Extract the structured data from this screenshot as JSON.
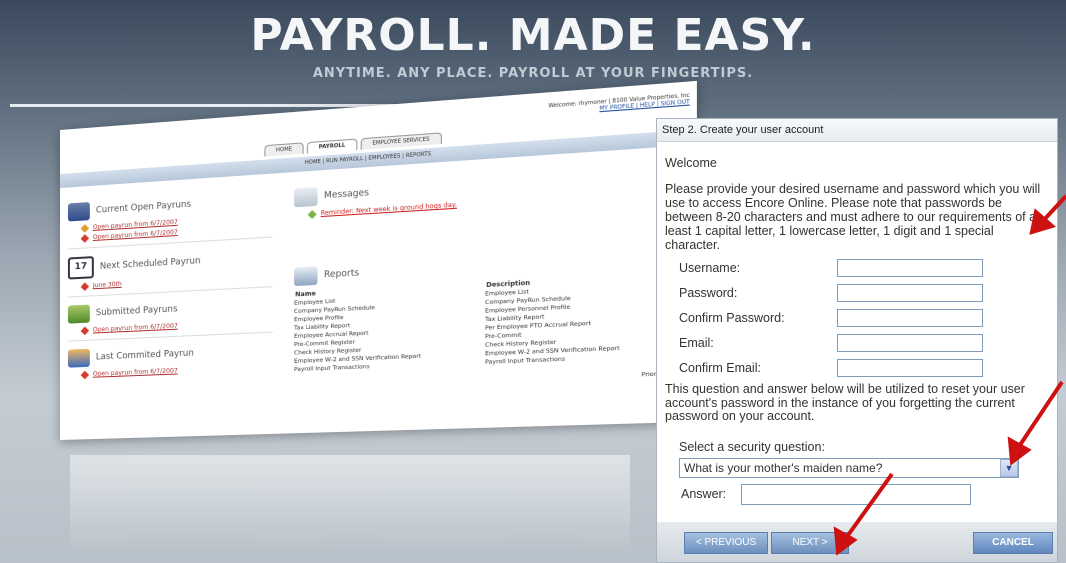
{
  "hero": {
    "title": "PAYROLL. MADE EASY.",
    "subtitle": "ANYTIME. ANY PLACE.  PAYROLL AT YOUR FINGERTIPS."
  },
  "mock": {
    "tabs": [
      "HOME",
      "PAYROLL",
      "EMPLOYEE SERVICES"
    ],
    "welcome_line": "Welcome: rhymoner | 8100 Value Properties, Inc",
    "welcome_links": "MY PROFILE | HELP | SIGN OUT",
    "subnav": "HOME | RUN PAYROLL | EMPLOYEES | REPORTS",
    "current_open_payruns": {
      "title": "Current Open Payruns",
      "items": [
        "Open payrun from 6/7/2007",
        "Open payrun from 6/7/2007"
      ]
    },
    "next_scheduled": {
      "title": "Next Scheduled Payrun",
      "date_icon": "17",
      "items": [
        "June 30th"
      ]
    },
    "submitted": {
      "title": "Submitted Payruns",
      "items": [
        "Open payrun from 6/7/2007"
      ]
    },
    "last_committed": {
      "title": "Last Commited Payrun",
      "items": [
        "Open payrun from 6/7/2007"
      ]
    },
    "messages": {
      "title": "Messages",
      "item": "Reminder: Next week is ground hogs day."
    },
    "reports": {
      "title": "Reports",
      "col_name": "Name",
      "col_desc": "Description",
      "rows": [
        [
          "Employee List",
          "Employee List"
        ],
        [
          "Company PayRun Schedule",
          "Company PayRun Schedule"
        ],
        [
          "Employee Profile",
          "Employee Personnel Profile"
        ],
        [
          "Tax Liability Report",
          "Tax Liability Report"
        ],
        [
          "Employee Accrual Report",
          "Per Employee PTO Accrual Report"
        ],
        [
          "Pre-Commit Register",
          "Pre-Commit"
        ],
        [
          "Check History Register",
          "Check History Register"
        ],
        [
          "Employee W-2 and SSN Verification Report",
          "Employee W-2 and SSN Verification Report"
        ],
        [
          "Payroll Input Transactions",
          "Payroll Input Transactions"
        ]
      ],
      "priority_label": "Priority Levels"
    }
  },
  "panel": {
    "header": "Step 2. Create your user account",
    "welcome": "Welcome",
    "intro": "Please provide your desired username and password which you will use to access Encore Online. Please note that passwords be between 8-20 characters and must adhere to our requirements of at least 1 capital letter, 1 lowercase letter, 1 digit and 1 special character.",
    "fields": {
      "username": "Username:",
      "password": "Password:",
      "confirm_password": "Confirm Password:",
      "email": "Email:",
      "confirm_email": "Confirm Email:"
    },
    "question_note": "This question and answer below will be utilized to reset your user account's password in the instance of you forgetting the current password on your account.",
    "select_label": "Select a security question:",
    "select_value": "What is your mother's maiden name?",
    "answer_label": "Answer:",
    "buttons": {
      "previous": "< PREVIOUS",
      "next": "NEXT >",
      "cancel": "CANCEL"
    }
  },
  "colors": {
    "annotation_arrow": "#cc1111",
    "button_blue": "#6b8fbd"
  }
}
